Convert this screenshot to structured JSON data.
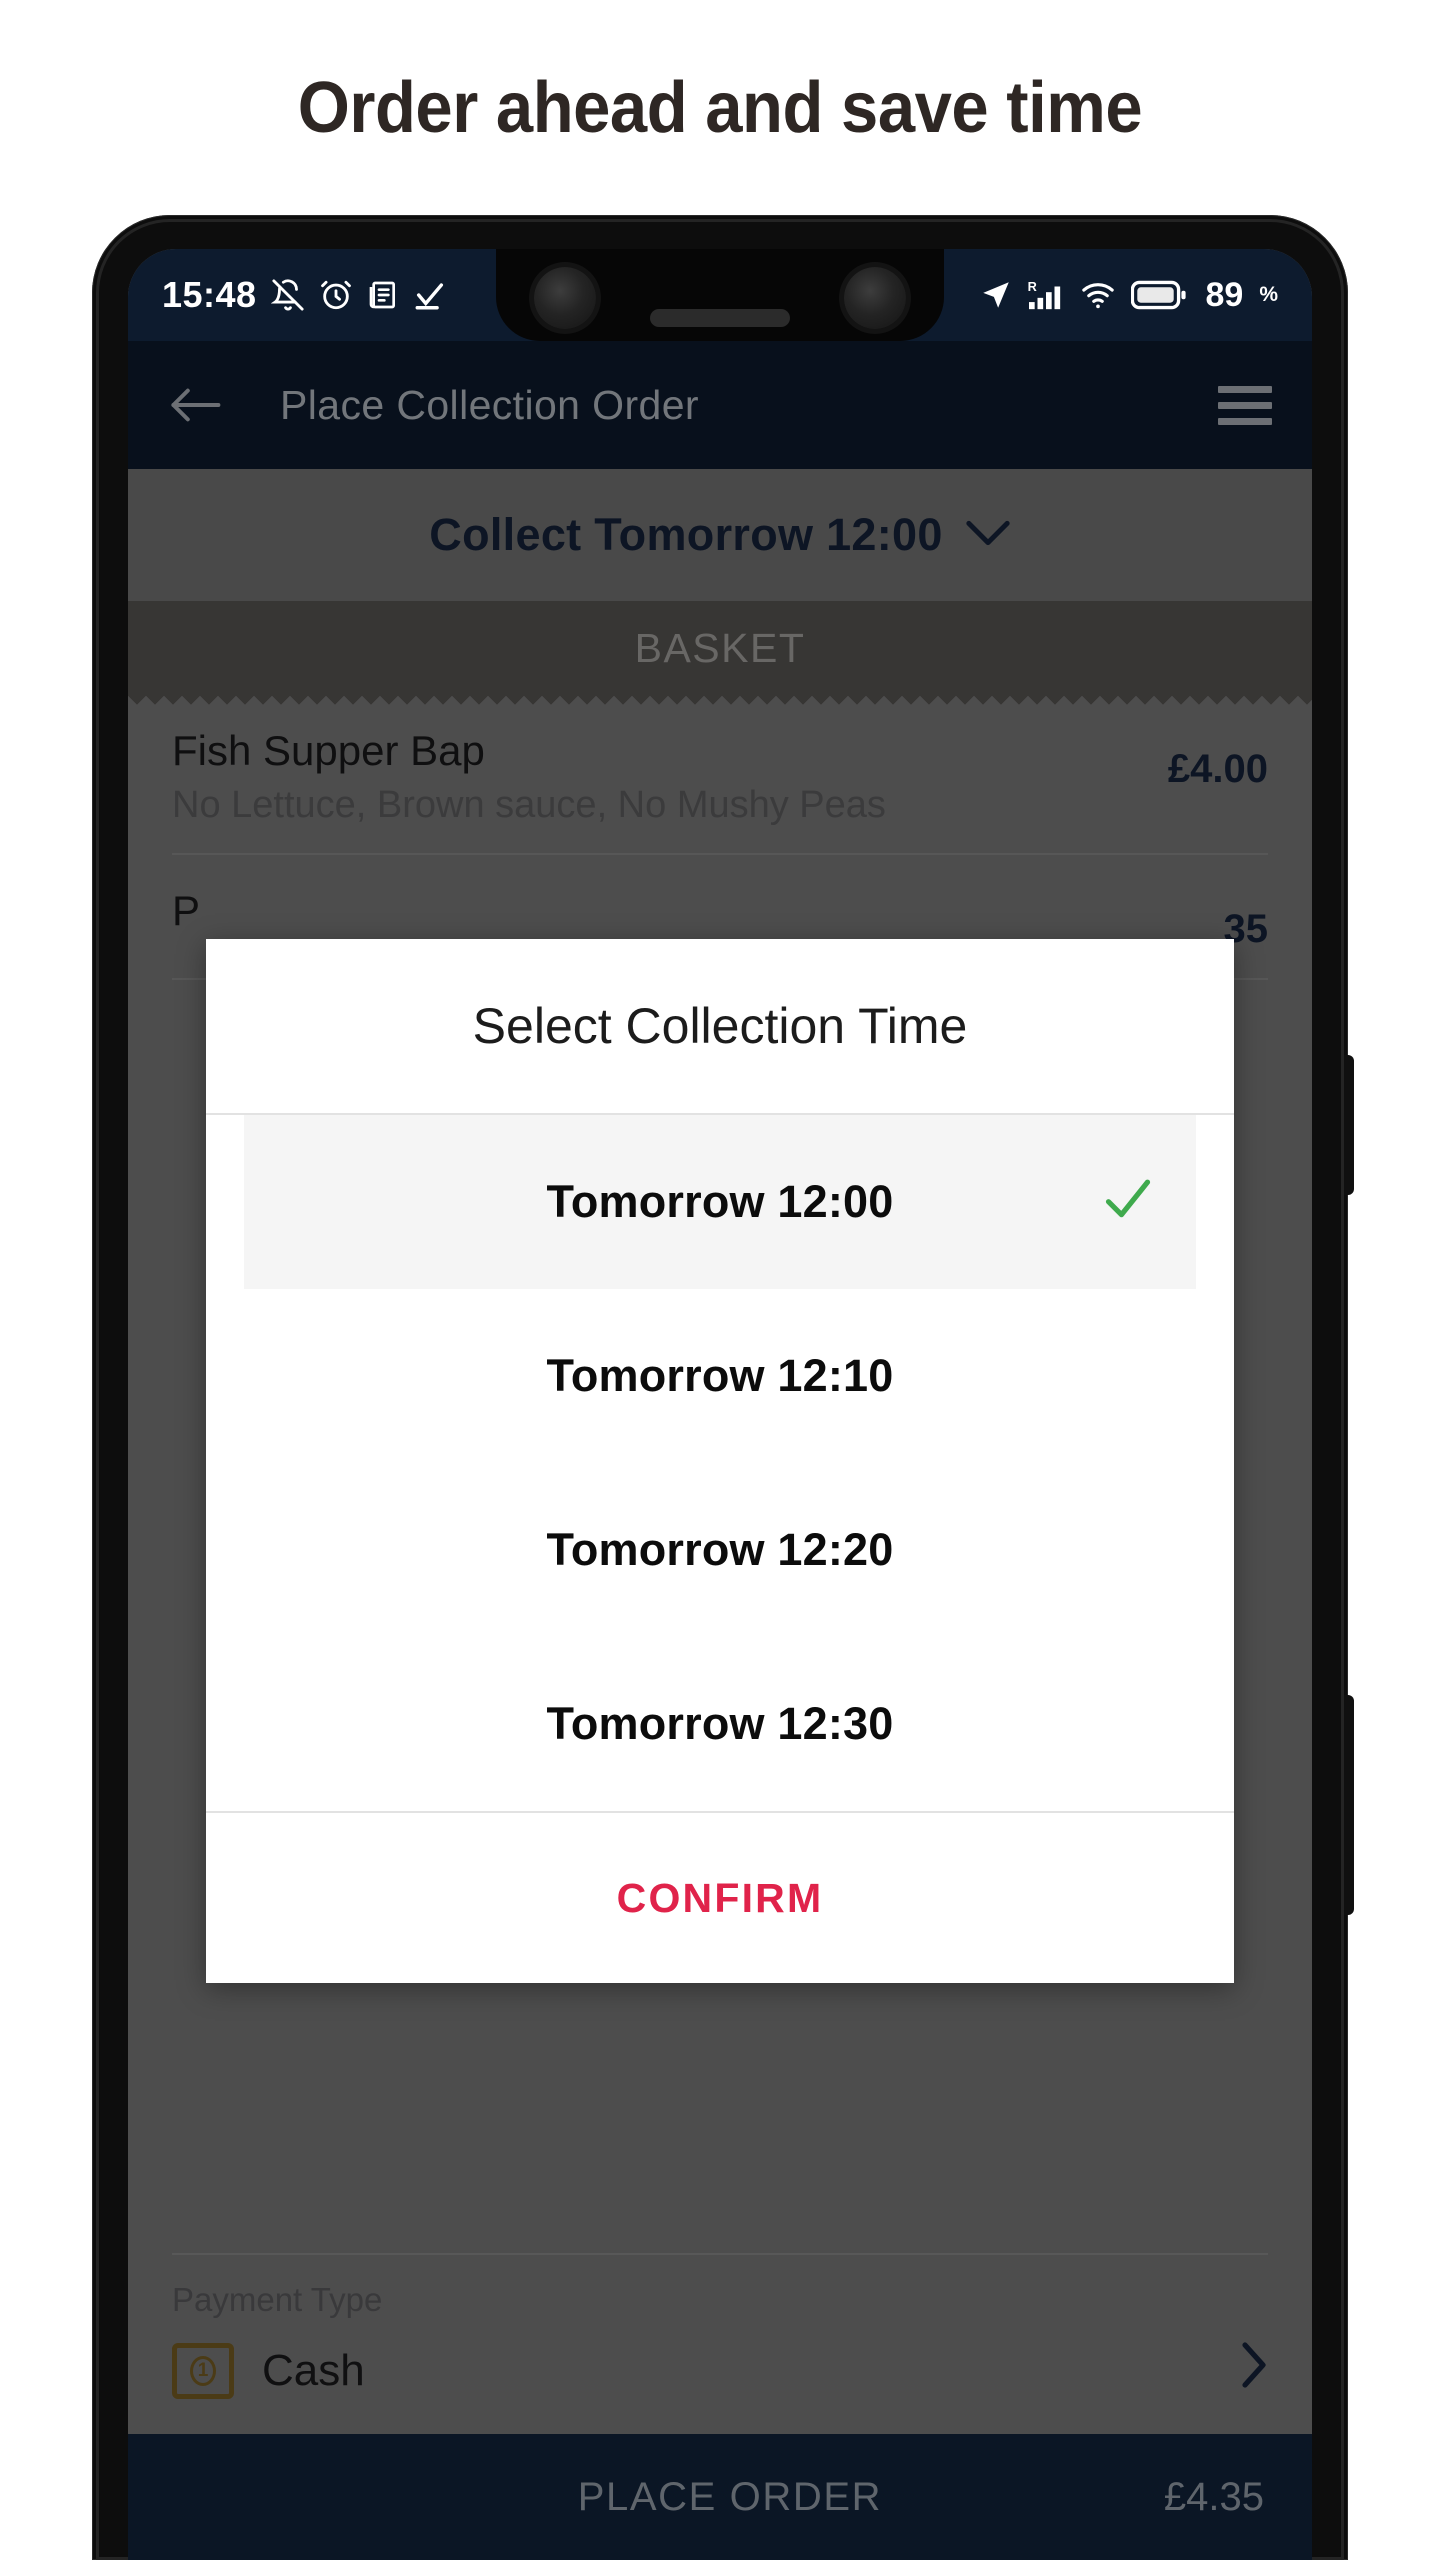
{
  "headline": "Order ahead and save time",
  "status_bar": {
    "time": "15:48",
    "battery_percent": "89",
    "percent_sign": "%",
    "left_icons": [
      "bell-off-icon",
      "alarm-icon",
      "document-icon",
      "checkmark-icon"
    ],
    "right_icons": [
      "location-arrow-icon",
      "signal-roaming-icon",
      "wifi-icon",
      "battery-icon"
    ],
    "roaming_label": "R",
    "background": "#0d1b2e"
  },
  "app_bar": {
    "title": "Place Collection Order",
    "back_icon": "back-arrow-icon",
    "menu_icon": "hamburger-menu-icon",
    "background": "#0d1b2e"
  },
  "collection_bar": {
    "label": "Collect Tomorrow 12:00",
    "chevron": "chevron-down-icon"
  },
  "basket": {
    "header": "BASKET",
    "items": [
      {
        "name": "Fish Supper Bap",
        "modifiers": "No Lettuce, Brown sauce, No Mushy Peas",
        "price": "£4.00"
      },
      {
        "name": "P",
        "modifiers": "",
        "price": "35"
      }
    ]
  },
  "payment": {
    "label": "Payment Type",
    "value": "Cash",
    "icon": "banknote-icon",
    "icon_glyph": "1",
    "chevron": "chevron-right-icon",
    "icon_color": "#7a6024"
  },
  "place_order": {
    "label": "PLACE ORDER",
    "total": "£4.35",
    "background": "#12243c"
  },
  "dialog": {
    "title": "Select Collection Time",
    "options": [
      {
        "label": "Tomorrow 12:00",
        "selected": true
      },
      {
        "label": "Tomorrow 12:10",
        "selected": false
      },
      {
        "label": "Tomorrow 12:20",
        "selected": false
      },
      {
        "label": "Tomorrow 12:30",
        "selected": false
      }
    ],
    "confirm_label": "CONFIRM",
    "confirm_color": "#e0234a",
    "check_icon": "checkmark-icon",
    "check_color": "#3faa4d"
  }
}
